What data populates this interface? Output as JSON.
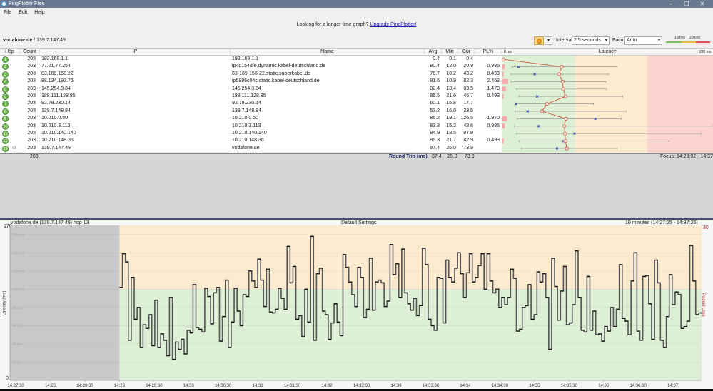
{
  "app": {
    "title": "PingPlotter Free",
    "menu": [
      "File",
      "Edit",
      "Help"
    ]
  },
  "banner": {
    "text": "Looking for a longer time graph?",
    "link": "Upgrade PingPlotter!"
  },
  "target": {
    "name": "vodafone.de",
    "ip": " / 139.7.147.49"
  },
  "toolbar": {
    "interval_label": "Interval",
    "interval_value": "2.5 seconds",
    "focus_label": "Focus",
    "focus_value": "Auto",
    "legend_100": "100ms",
    "legend_200": "200ms",
    "pause_icon": "pause-icon"
  },
  "table": {
    "headers": {
      "hop": "Hop",
      "count": "Count",
      "ip": "IP",
      "name": "Name",
      "avg": "Avg",
      "min": "Min",
      "cur": "Cur",
      "pl": "PL%",
      "latency": "Latency",
      "lat_min": "0 ms",
      "lat_max": "290 ms"
    },
    "rows": [
      {
        "hop": "1",
        "count": "203",
        "ip": "192.168.1.1",
        "name": "192.168.1.1",
        "avg": "0.4",
        "min": "0.1",
        "cur": "0.4",
        "pl": "",
        "max": 1
      },
      {
        "hop": "2",
        "count": "203",
        "ip": "77.21.77.254",
        "name": "ip4d154dfe.dynamic.kabel-deutschland.de",
        "avg": "80.4",
        "min": "12.0",
        "cur": "20.9",
        "pl": "0.985",
        "max": 156
      },
      {
        "hop": "3",
        "count": "203",
        "ip": "83.169.158.22",
        "name": "83-169-158-22.static.superkabel.de",
        "avg": "76.7",
        "min": "10.2",
        "cur": "43.2",
        "pl": "0.493",
        "max": 145
      },
      {
        "hop": "4",
        "count": "203",
        "ip": "88.134.192.76",
        "name": "ip5886c04c.static.kabel-deutschland.de",
        "avg": "81.6",
        "min": "10.9",
        "cur": "82.3",
        "pl": "2.463",
        "max": 141
      },
      {
        "hop": "5",
        "count": "203",
        "ip": "145.254.3.84",
        "name": "145.254.3.84",
        "avg": "82.4",
        "min": "18.4",
        "cur": "83.5",
        "pl": "1.478",
        "max": 142
      },
      {
        "hop": "6",
        "count": "203",
        "ip": "188.111.128.85",
        "name": "188.111.128.85",
        "avg": "85.5",
        "min": "21.6",
        "cur": "46.7",
        "pl": "0.493",
        "max": 164
      },
      {
        "hop": "7",
        "count": "203",
        "ip": "92.79.230.14",
        "name": "92.79.230.14",
        "avg": "60.1",
        "min": "15.8",
        "cur": "17.7",
        "pl": "",
        "max": 124
      },
      {
        "hop": "8",
        "count": "203",
        "ip": "139.7.148.84",
        "name": "139.7.148.84",
        "avg": "53.2",
        "min": "16.0",
        "cur": "33.5",
        "pl": "",
        "max": 169
      },
      {
        "hop": "9",
        "count": "203",
        "ip": "10.210.0.50",
        "name": "10.210.0.50",
        "avg": "86.2",
        "min": "19.1",
        "cur": "126.5",
        "pl": "1.970",
        "max": 162
      },
      {
        "hop": "10",
        "count": "203",
        "ip": "10.210.3.113",
        "name": "10.210.3.113",
        "avg": "83.8",
        "min": "15.2",
        "cur": "48.6",
        "pl": "0.985",
        "max": 287
      },
      {
        "hop": "11",
        "count": "203",
        "ip": "10.210.140.140",
        "name": "10.210.140.140",
        "avg": "84.9",
        "min": "18.5",
        "cur": "97.9",
        "pl": "",
        "max": 272
      },
      {
        "hop": "12",
        "count": "203",
        "ip": "10.210.148.36",
        "name": "10.210.148.36",
        "avg": "85.3",
        "min": "21.7",
        "cur": "82.9",
        "pl": "0.493",
        "max": 228
      },
      {
        "hop": "13",
        "count": "203",
        "ip": "139.7.147.49",
        "name": "vodafone.de",
        "avg": "87.4",
        "min": "25.0",
        "cur": "73.9",
        "pl": "",
        "max": 156
      }
    ],
    "summary": {
      "count": "203",
      "label": "Round Trip (ms)",
      "avg": "87.4",
      "min": "25.0",
      "cur": "73.9",
      "focus": "Focus: 14:29:02 - 14:37:25"
    }
  },
  "colors": {
    "green_zone": "#ddf0d5",
    "orange_zone": "#fdebcf",
    "red_zone": "#fdd3cf",
    "hop_green": "#6fb34e",
    "avg_line": "#d0553f",
    "cur_marker": "#2a3cb0",
    "pl_bar": "#f4a9ad",
    "no_data": "#c8c8c8"
  },
  "graph": {
    "target": "vodafone.de (139.7.147.49) hop 13",
    "settings": "Default Settings",
    "range": "10 minutes (14:27:25 - 14:37:25)",
    "loss_max": "30",
    "loss_label": "Packet Loss %",
    "y_label": "Latency (ms)",
    "y_top": "170",
    "y_bottom": "0"
  },
  "chart_data": {
    "type": "line",
    "step": true,
    "ylabel": "Latency (ms)",
    "y2label": "Packet Loss %",
    "ylim": [
      0,
      170
    ],
    "y2lim": [
      0,
      30
    ],
    "xlim": [
      "14:27:25",
      "14:37:25"
    ],
    "x_ticks": [
      "14:27:30",
      "14:28",
      "14:28:30",
      "14:29",
      "14:29:30",
      "14:30",
      "14:30:30",
      "14:31",
      "14:31:30",
      "14:32",
      "14:32:30",
      "14:33",
      "14:33:30",
      "14:34",
      "14:34:30",
      "14:35",
      "14:35:30",
      "14:36",
      "14:36:30",
      "14:37"
    ],
    "y_ticks": [
      "20 ms",
      "40 ms",
      "60 ms",
      "80 ms",
      "100 ms",
      "120 ms",
      "140 ms",
      "160 ms"
    ],
    "threshold_ms": 100,
    "no_data_until": "14:29",
    "x_start": "14:29",
    "x_end": "14:37:25",
    "values": [
      102,
      139,
      130,
      44,
      113,
      67,
      80,
      36,
      61,
      57,
      72,
      38,
      88,
      36,
      51,
      44,
      27,
      91,
      23,
      42,
      34,
      45,
      29,
      55,
      52,
      105,
      58,
      56,
      53,
      101,
      92,
      62,
      96,
      102,
      43,
      70,
      110,
      36,
      64,
      101,
      76,
      60,
      94,
      92,
      120,
      109,
      102,
      133,
      110,
      81,
      122,
      75,
      74,
      78,
      101,
      90,
      78,
      147,
      107,
      125,
      67,
      71,
      48,
      100,
      64,
      158,
      44,
      117,
      123,
      76,
      72,
      45,
      63,
      84,
      64,
      49,
      138,
      124,
      108,
      94,
      81,
      124,
      113,
      69,
      78,
      134,
      77,
      108,
      110,
      107,
      81,
      87,
      149,
      116,
      128,
      91,
      144,
      96,
      84,
      77,
      90,
      71,
      82,
      145,
      127,
      67,
      60,
      55,
      113,
      112,
      63,
      132,
      113,
      108,
      123,
      140,
      117,
      91,
      118,
      139,
      108,
      113,
      126,
      139,
      100,
      139,
      109,
      96,
      100,
      80,
      91,
      83,
      91,
      122,
      112,
      54,
      56,
      80,
      82,
      105,
      67,
      72,
      119,
      108,
      117,
      91,
      34,
      134,
      103,
      66,
      98,
      125,
      61,
      63,
      83,
      142,
      91,
      55,
      53,
      114,
      55,
      76,
      50,
      51,
      43,
      59,
      54,
      80,
      59,
      78,
      127,
      68,
      65,
      50,
      109,
      140,
      54,
      44,
      114,
      115,
      84,
      45,
      132,
      107,
      44,
      36,
      70,
      116,
      83,
      97,
      94,
      57,
      59,
      65,
      148,
      109,
      72,
      74
    ]
  }
}
